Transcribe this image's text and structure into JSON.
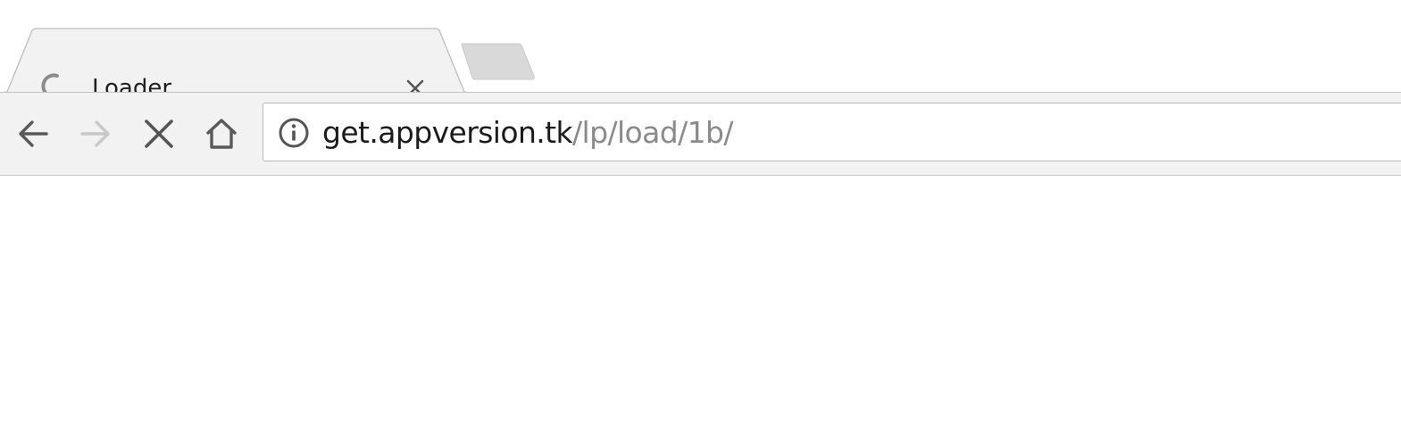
{
  "tab": {
    "title": "Loader",
    "close_icon": "close-icon",
    "loading_icon": "loading-spinner-icon"
  },
  "new_tab": {
    "icon": "new-tab-button"
  },
  "toolbar": {
    "back_icon": "arrow-left-icon",
    "forward_icon": "arrow-right-icon",
    "stop_icon": "stop-x-icon",
    "home_icon": "home-icon"
  },
  "omnibox": {
    "info_icon": "info-circle-icon",
    "url_host": "get.appversion.tk",
    "url_path": "/lp/load/1b/"
  },
  "colors": {
    "toolbar_bg": "#f2f2f2",
    "tab_bg": "#f2f2f2",
    "url_host": "#1b1b1b",
    "url_path": "#8a8a8a",
    "icon": "#5a5a5a",
    "icon_disabled": "#c8c8c8"
  }
}
